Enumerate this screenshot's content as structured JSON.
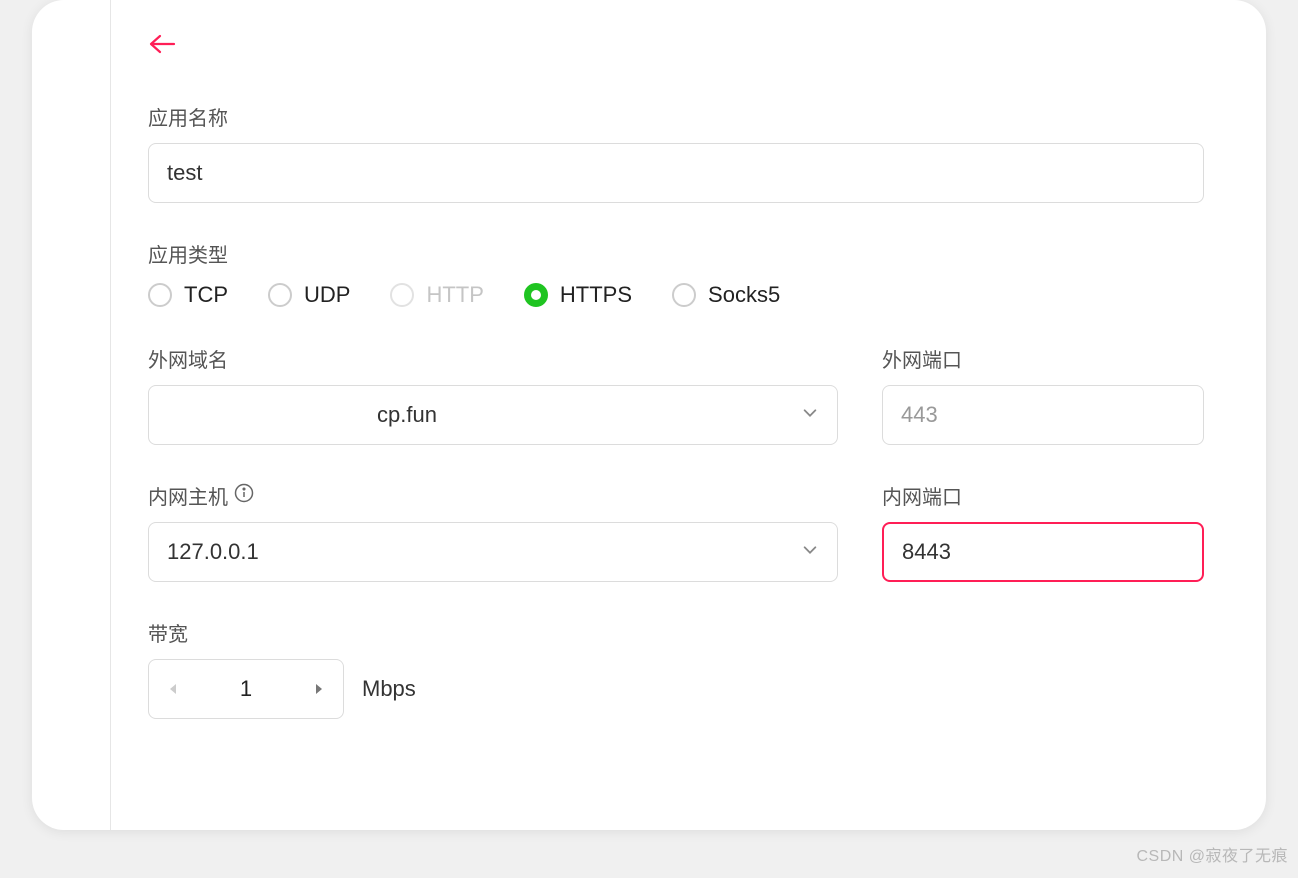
{
  "form": {
    "app_name": {
      "label": "应用名称",
      "value": "test"
    },
    "app_type": {
      "label": "应用类型",
      "options": [
        {
          "key": "tcp",
          "label": "TCP",
          "disabled": false
        },
        {
          "key": "udp",
          "label": "UDP",
          "disabled": false
        },
        {
          "key": "http",
          "label": "HTTP",
          "disabled": true
        },
        {
          "key": "https",
          "label": "HTTPS",
          "disabled": false
        },
        {
          "key": "socks5",
          "label": "Socks5",
          "disabled": false
        }
      ],
      "selected": "https"
    },
    "ext_domain": {
      "label": "外网域名",
      "value_suffix": "cp.fun"
    },
    "ext_port": {
      "label": "外网端口",
      "placeholder": "443"
    },
    "int_host": {
      "label": "内网主机",
      "value": "127.0.0.1"
    },
    "int_port": {
      "label": "内网端口",
      "value": "8443"
    },
    "bandwidth": {
      "label": "带宽",
      "value": "1",
      "unit": "Mbps"
    }
  },
  "watermark": "CSDN @寂夜了无痕",
  "colors": {
    "accent_green": "#1fc421",
    "accent_pink": "#ff1e56"
  }
}
